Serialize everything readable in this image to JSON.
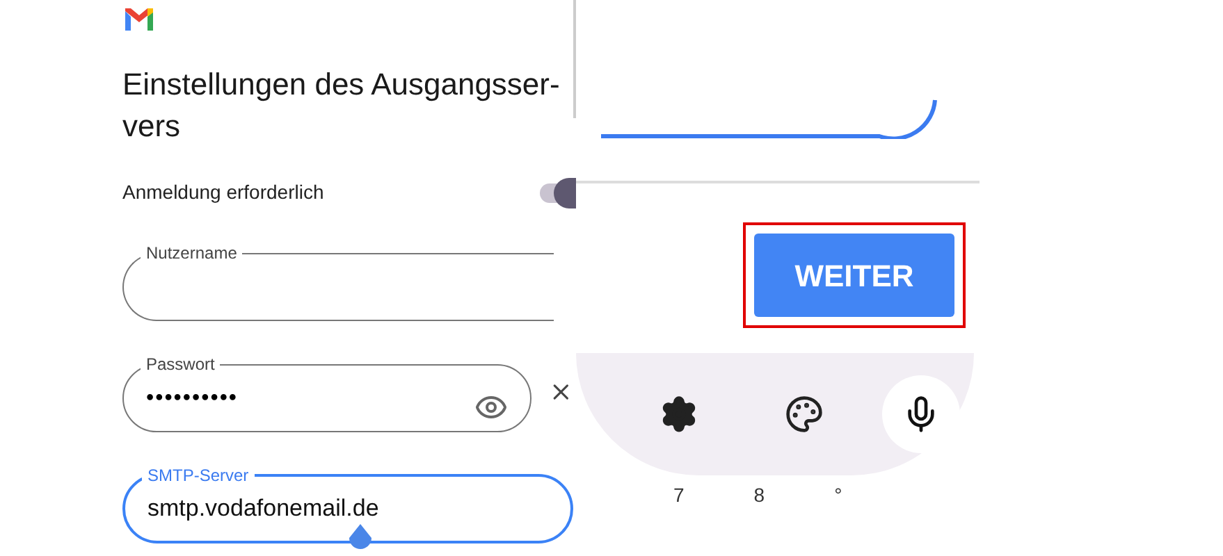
{
  "title": "Einstellungen des Ausgangsser-vers",
  "toggle": {
    "label": "Anmeldung erforderlich",
    "on": true
  },
  "fields": [
    {
      "kind": "text",
      "label": "Nutzername",
      "focused": false
    },
    {
      "kind": "password",
      "label": "Passwort",
      "value": "••••••••••",
      "focused": false
    },
    {
      "kind": "text",
      "label": "SMTP-Server",
      "value": "smtp.vodafonemail.de",
      "focused": true
    }
  ],
  "button": {
    "label": "WEITER",
    "highlighted": true
  },
  "keyboard": {
    "keys": [
      "7",
      "8",
      "°"
    ]
  }
}
